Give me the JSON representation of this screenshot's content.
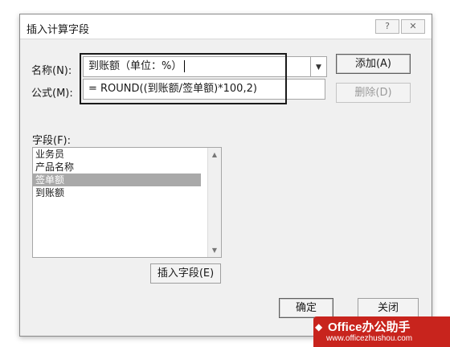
{
  "dialog": {
    "title": "插入计算字段",
    "help_label": "?",
    "close_label": "✕",
    "name_label": "名称(N):",
    "name_value": "到账额（单位：%）",
    "formula_label": "公式(M):",
    "formula_value": "= ROUND((到账额/签单额)*100,2)",
    "add_button": "添加(A)",
    "delete_button": "删除(D)",
    "fields_label": "字段(F):",
    "fields": [
      "业务员",
      "产品名称",
      "签单额",
      "到账额"
    ],
    "selected_field": "签单额",
    "insert_field_button": "插入字段(E)",
    "ok_button": "确定",
    "close_button": "关闭"
  },
  "watermark": {
    "brand": "Office办公助手",
    "url": "www.officezhushou.com"
  },
  "colors": {
    "dialog_bg": "#f0f0f0",
    "selection": "#a9a9a9",
    "watermark_red": "#c8241d"
  }
}
